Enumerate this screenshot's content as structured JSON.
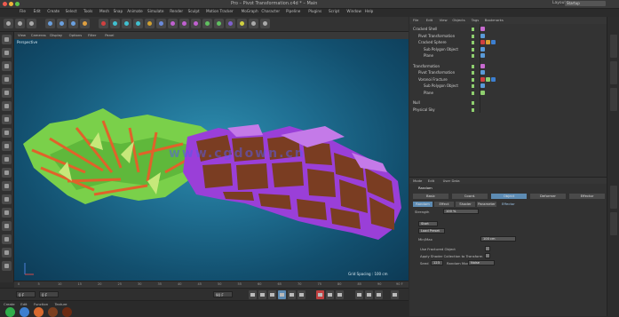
{
  "window": {
    "title": "Pro – Pivot Transformation.c4d * – Main",
    "layout_label": "Layout:",
    "layout_value": "Startup"
  },
  "menu": [
    "File",
    "Edit",
    "Create",
    "Select",
    "Tools",
    "Mesh",
    "Snap",
    "Animate",
    "Simulate",
    "Render",
    "Sculpt",
    "Motion Tracker",
    "MoGraph",
    "Character",
    "Pipeline",
    "Plugins",
    "Script",
    "Window",
    "Help"
  ],
  "viewport": {
    "menu": [
      "View",
      "Cameras",
      "Display",
      "Options",
      "Filter",
      "Panel"
    ],
    "label": "Perspective",
    "grid_spacing": "Grid Spacing : 100 cm",
    "watermark": "www.cgdown.cn"
  },
  "timeline": {
    "ticks": [
      "0",
      "5",
      "10",
      "15",
      "20",
      "25",
      "30",
      "35",
      "40",
      "45",
      "50",
      "55",
      "60",
      "65",
      "70",
      "75",
      "80",
      "85",
      "90"
    ],
    "end_frame": "90 F",
    "current_frame": "0 F",
    "start_field": "0 F",
    "end_field": "90 F"
  },
  "materials": {
    "menu": [
      "Create",
      "Edit",
      "Function",
      "Texture"
    ],
    "swatches": [
      "#2fae4b",
      "#3d7fd0",
      "#d8692e",
      "#7b3f1f",
      "#6b2a12"
    ]
  },
  "objects": {
    "menu": [
      "File",
      "Edit",
      "View",
      "Objects",
      "Tags",
      "Bookmarks"
    ],
    "rows": [
      {
        "name": "Cracked Shell",
        "indent": 0,
        "tags": [
          "#c86ad0"
        ]
      },
      {
        "name": "Pivot Transformation",
        "indent": 1,
        "tags": [
          "#5a9ad8"
        ]
      },
      {
        "name": "Cracked Sphere",
        "indent": 1,
        "tags": [
          "#d04040",
          "#d8a030",
          "#3d7fd0"
        ]
      },
      {
        "name": "Sub Polygon Object",
        "indent": 2,
        "tags": [
          "#5a9ad8"
        ]
      },
      {
        "name": "Plane",
        "indent": 2,
        "tags": [
          "#5a9ad8"
        ]
      },
      {
        "name": "Transformation",
        "indent": 0,
        "tags": [
          "#c86ad0"
        ]
      },
      {
        "name": "Pivot Transformation",
        "indent": 1,
        "tags": [
          "#5a9ad8"
        ]
      },
      {
        "name": "Voronoi Fracture",
        "indent": 1,
        "tags": [
          "#d04040",
          "#8fcf6f",
          "#3d7fd0"
        ]
      },
      {
        "name": "Sub Polygon Object",
        "indent": 2,
        "tags": [
          "#5a9ad8"
        ]
      },
      {
        "name": "Plane",
        "indent": 2,
        "tags": [
          "#8fcf6f"
        ]
      },
      {
        "name": "Null",
        "indent": 0,
        "tags": []
      },
      {
        "name": "Physical Sky",
        "indent": 0,
        "tags": []
      }
    ]
  },
  "attributes": {
    "menu": [
      "Mode",
      "Edit",
      "User Data"
    ],
    "object_name": "Random",
    "tabs": [
      "Basic",
      "Coord.",
      "Object",
      "Deformer",
      "Effector"
    ],
    "subtabs": [
      "Random",
      "Effect",
      "Shader",
      "Parameter"
    ],
    "section": "Effector",
    "strength_label": "Strength",
    "strength_value": "100 %",
    "btn_a": "Start",
    "btn_b": "Load Preset",
    "field_label": "Min/Max",
    "field_value": "100 cm",
    "options": [
      "Use Fractured Object",
      "Apply Shader Collection to Transform",
      "Seed"
    ],
    "seed_value": "123",
    "random_mode_label": "Random Mode",
    "random_mode_value": "Noise"
  }
}
